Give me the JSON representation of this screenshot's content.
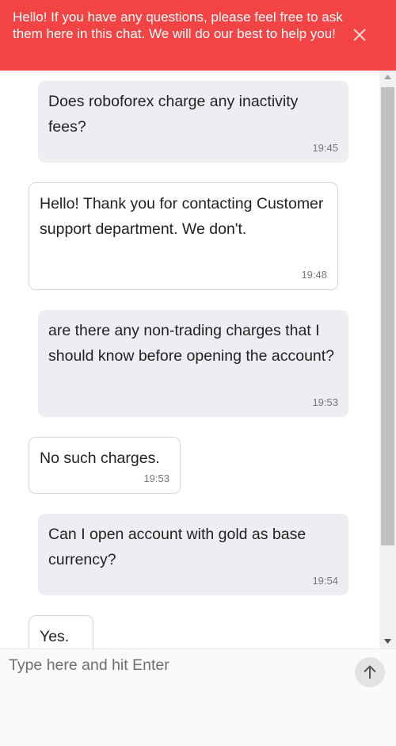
{
  "banner": {
    "text": "Hello! If you have any questions, please feel free to ask them here in this chat. We will do our best to help you!",
    "close_icon": "close-icon",
    "color": "#f24444"
  },
  "messages": [
    {
      "sender": "user",
      "text": "Does roboforex charge any inactivity fees?",
      "time": "19:45"
    },
    {
      "sender": "agent",
      "text": "Hello! Thank you for contacting Customer support department. We don't.",
      "time": "19:48"
    },
    {
      "sender": "user",
      "text": "are there any non-trading charges that I should know before opening the account?",
      "time": "19:53"
    },
    {
      "sender": "agent",
      "text": "No such charges.",
      "time": "19:53"
    },
    {
      "sender": "user",
      "text": "Can I open account with gold as base currency?",
      "time": "19:54"
    },
    {
      "sender": "agent",
      "text": "Yes.",
      "time": ""
    }
  ],
  "input": {
    "placeholder": "Type here and hit Enter",
    "value": ""
  },
  "send_button": {
    "icon": "arrow-up-icon"
  },
  "scrollbar": {
    "up_icon": "triangle-up-icon",
    "down_icon": "triangle-down-icon"
  }
}
